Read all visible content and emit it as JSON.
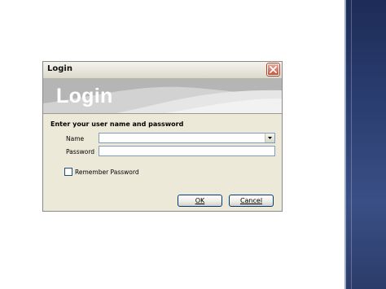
{
  "dialog": {
    "title": "Login",
    "banner_title": "Login",
    "instruction": "Enter your user name and password",
    "name_label": "Name",
    "name_value": "",
    "password_label": "Password",
    "password_value": "",
    "remember_label": "Remember Password",
    "remember_checked": false,
    "ok_label": "OK",
    "cancel_label": "Cancel",
    "icons": {
      "close": "close-icon",
      "dropdown": "chevron-down-icon"
    },
    "colors": {
      "dialog_bg": "#ece9d8",
      "banner_bg": "#b5b5b5",
      "close_button": "#c6543d",
      "input_border": "#7f9db9",
      "button_border": "#003c74"
    }
  },
  "slide": {
    "side_panel_color": "#2a3d70"
  }
}
